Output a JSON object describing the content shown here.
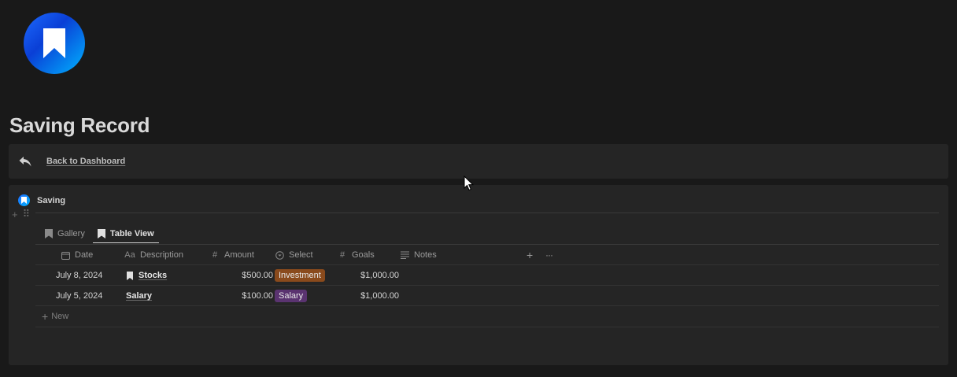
{
  "page": {
    "title": "Saving Record",
    "icon": "bookmark-icon",
    "brand_gradient": [
      "#1e6bff",
      "#00b4ff"
    ]
  },
  "callout": {
    "icon": "reply-arrow-icon",
    "link_label": "Back to Dashboard"
  },
  "database": {
    "title": "Saving",
    "icon": "bookmark-icon",
    "tabs": [
      {
        "label": "Gallery",
        "icon": "bookmark-icon",
        "active": false
      },
      {
        "label": "Table View",
        "icon": "bookmark-icon",
        "active": true
      }
    ],
    "columns": [
      {
        "label": "Date",
        "icon": "calendar-icon"
      },
      {
        "label": "Description",
        "icon": "text-aa-icon"
      },
      {
        "label": "Amount",
        "icon": "hash-icon"
      },
      {
        "label": "Select",
        "icon": "select-chevron-icon"
      },
      {
        "label": "Goals",
        "icon": "hash-icon"
      },
      {
        "label": "Notes",
        "icon": "lines-icon"
      }
    ],
    "add_column_label": "+",
    "more_label": "···",
    "rows": [
      {
        "date": "July 8, 2024",
        "description": "Stocks",
        "has_icon": true,
        "amount": "$500.00",
        "select": "Investment",
        "select_color": "#8a4a1c",
        "goals": "$1,000.00",
        "notes": ""
      },
      {
        "date": "July 5, 2024",
        "description": "Salary",
        "has_icon": false,
        "amount": "$100.00",
        "select": "Salary",
        "select_color": "#5a3370",
        "goals": "$1,000.00",
        "notes": ""
      }
    ],
    "new_label": "New"
  }
}
